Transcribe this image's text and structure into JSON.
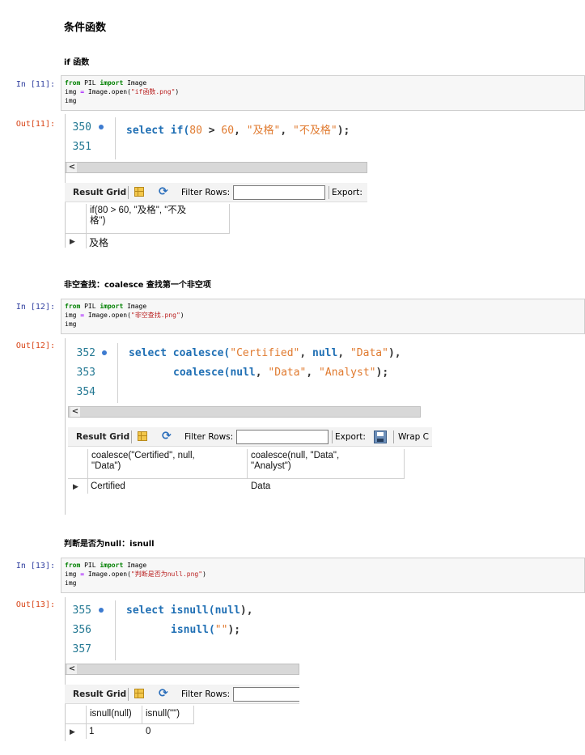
{
  "title": "条件函数",
  "sections": [
    {
      "heading": "if 函数",
      "in_prompt": "In  [11]:",
      "out_prompt": "Out[11]:",
      "code": {
        "l1_kw1": "from",
        "l1_mid": " PIL ",
        "l1_kw2": "import",
        "l1_end": " Image",
        "l2_a": "img ",
        "l2_op": "=",
        "l2_b": " Image.open(",
        "l2_str": "\"if函数.png\"",
        "l2_c": ")",
        "l3": "img"
      },
      "lines": [
        "350",
        "351"
      ],
      "sql": {
        "kw": "select",
        "fn": " if(",
        "n1": "80",
        "op": " > ",
        "n2": "60",
        "c1": ", ",
        "s1": "\"及格\"",
        "c2": ", ",
        "s2": "\"不及格\"",
        "end": ");"
      },
      "toolbar": {
        "result_grid": "Result Grid",
        "filter": "Filter Rows:",
        "export": "Export:"
      },
      "columns": [
        "if(80 > 60, \"及格\", \"不及\n格\")"
      ],
      "rows": [
        [
          "及格"
        ]
      ]
    },
    {
      "heading": "非空查找：coalesce 查找第一个非空项",
      "in_prompt": "In  [12]:",
      "out_prompt": "Out[12]:",
      "code": {
        "l1_kw1": "from",
        "l1_mid": " PIL ",
        "l1_kw2": "import",
        "l1_end": " Image",
        "l2_a": "img ",
        "l2_op": "=",
        "l2_b": " Image.open(",
        "l2_str": "\"非空查找.png\"",
        "l2_c": ")",
        "l3": "img"
      },
      "lines": [
        "352",
        "353",
        "354"
      ],
      "sql": {
        "kw": "select",
        "fn1": " coalesce(",
        "s1": "\"Certified\"",
        "c1": ", ",
        "null1": "null",
        "c2": ", ",
        "s2": "\"Data\"",
        "end1": "),",
        "fn2": "coalesce(",
        "null2": "null",
        "c3": ", ",
        "s3": "\"Data\"",
        "c4": ", ",
        "s4": "\"Analyst\"",
        "end2": ");"
      },
      "toolbar": {
        "result_grid": "Result Grid",
        "filter": "Filter Rows:",
        "export": "Export:",
        "wrap": "Wrap C"
      },
      "columns": [
        "coalesce(\"Certified\", null,\n\"Data\")",
        "coalesce(null, \"Data\",\n\"Analyst\")"
      ],
      "rows": [
        [
          "Certified",
          "Data"
        ]
      ]
    },
    {
      "heading": "判断是否为null：isnull",
      "in_prompt": "In  [13]:",
      "out_prompt": "Out[13]:",
      "code": {
        "l1_kw1": "from",
        "l1_mid": " PIL ",
        "l1_kw2": "import",
        "l1_end": " Image",
        "l2_a": "img ",
        "l2_op": "=",
        "l2_b": " Image.open(",
        "l2_str": "\"判断是否为null.png\"",
        "l2_c": ")",
        "l3": "img"
      },
      "lines": [
        "355",
        "356",
        "357"
      ],
      "sql": {
        "kw": "select",
        "fn1": " isnull(",
        "null1": "null",
        "end1": "),",
        "fn2": "isnull(",
        "s1": "\"\"",
        "end2": ");"
      },
      "toolbar": {
        "result_grid": "Result Grid",
        "filter": "Filter Rows:"
      },
      "columns": [
        "isnull(null)",
        "isnull(\"\")"
      ],
      "rows": [
        [
          "1",
          "0"
        ]
      ]
    }
  ],
  "ui": {
    "scroll_left": "<",
    "row_marker": "▶"
  }
}
